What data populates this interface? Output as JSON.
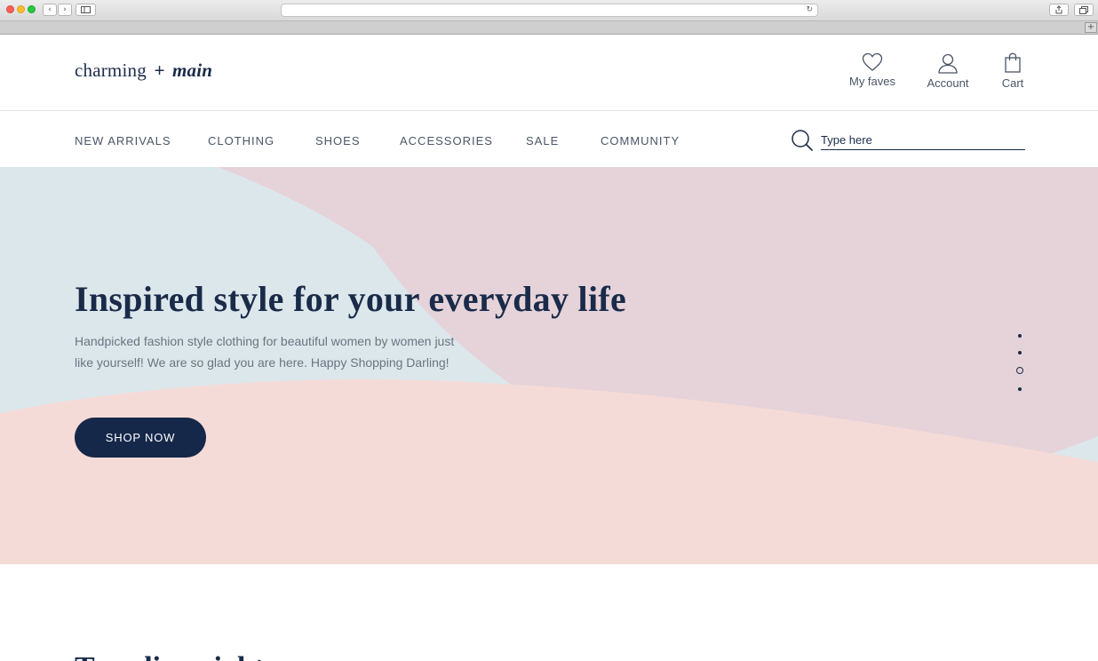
{
  "browser": {
    "url_text": "",
    "new_tab_label": "+"
  },
  "header": {
    "logo": {
      "part1": "charming",
      "plus": "+",
      "part2": "main"
    },
    "actions": [
      {
        "label": "My faves",
        "icon": "heart-icon"
      },
      {
        "label": "Account",
        "icon": "user-icon"
      },
      {
        "label": "Cart",
        "icon": "shopping-bag-icon"
      }
    ]
  },
  "nav": {
    "items": [
      {
        "label": "NEW ARRIVALS"
      },
      {
        "label": "CLOTHING"
      },
      {
        "label": "SHOES"
      },
      {
        "label": "ACCESSORIES"
      },
      {
        "label": "SALE"
      },
      {
        "label": "COMMUNITY"
      }
    ],
    "search": {
      "placeholder": "Type here",
      "value": "",
      "icon": "search-icon"
    }
  },
  "hero": {
    "title": "Inspired style for your everyday life",
    "subtitle": "Handpicked fashion style clothing for beautiful women by women just like yourself! We are so glad you are here. Happy Shopping Darling!",
    "cta_label": "SHOP NOW",
    "carousel": {
      "slide_count": 4,
      "active_index": 2
    },
    "colors": {
      "base": "#dce7ec",
      "pink_top": "#e5d3d9",
      "peach_bottom": "#f5dbd7",
      "navy": "#15284a"
    }
  },
  "section": {
    "title": "Trending right now"
  }
}
